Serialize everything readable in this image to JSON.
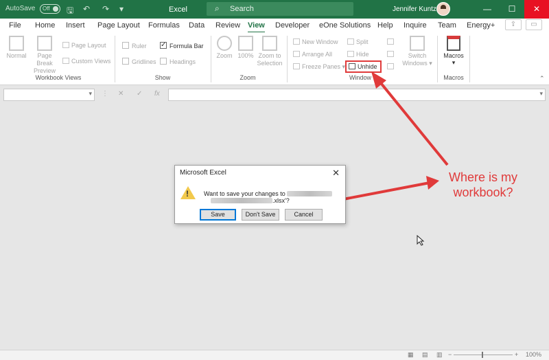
{
  "titlebar": {
    "autosave": "AutoSave",
    "toggle": "Off",
    "app_title": "Excel",
    "search_placeholder": "Search",
    "user_name": "Jennifer Kuntz",
    "min": "—",
    "restore": "☐",
    "close": "✕"
  },
  "tabs": [
    "File",
    "Home",
    "Insert",
    "Page Layout",
    "Formulas",
    "Data",
    "Review",
    "View",
    "Developer",
    "eOne Solutions",
    "Help",
    "Inquire",
    "Team",
    "Energy+"
  ],
  "active_tab": "View",
  "ribbon": {
    "workbook_views": {
      "label": "Workbook Views",
      "normal": "Normal",
      "page_break_1": "Page Break",
      "page_break_2": "Preview",
      "page_layout": "Page Layout",
      "custom_views": "Custom Views"
    },
    "show": {
      "label": "Show",
      "ruler": "Ruler",
      "formula_bar": "Formula Bar",
      "gridlines": "Gridlines",
      "headings": "Headings"
    },
    "zoom": {
      "label": "Zoom",
      "zoom": "Zoom",
      "hundred": "100%",
      "zoom_sel_1": "Zoom to",
      "zoom_sel_2": "Selection"
    },
    "window": {
      "label": "Window",
      "new_window": "New Window",
      "arrange_all": "Arrange All",
      "freeze_panes": "Freeze Panes",
      "split": "Split",
      "hide": "Hide",
      "unhide": "Unhide",
      "switch_1": "Switch",
      "switch_2": "Windows"
    },
    "macros": {
      "label": "Macros",
      "button": "Macros"
    }
  },
  "formula_bar": {
    "cancel": "✕",
    "enter": "✓",
    "fx": "fx",
    "dots": "⋮"
  },
  "dialog": {
    "title": "Microsoft Excel",
    "msg_part1": "Want to save your changes to '",
    "msg_part2": ".xlsx'?",
    "save": "Save",
    "dont_save": "Don't Save",
    "cancel": "Cancel"
  },
  "annotation": {
    "line1": "Where is my",
    "line2": "workbook?",
    "color": "#e03a3a"
  },
  "status": {
    "zoom": "100%",
    "minus": "−",
    "plus": "+"
  }
}
